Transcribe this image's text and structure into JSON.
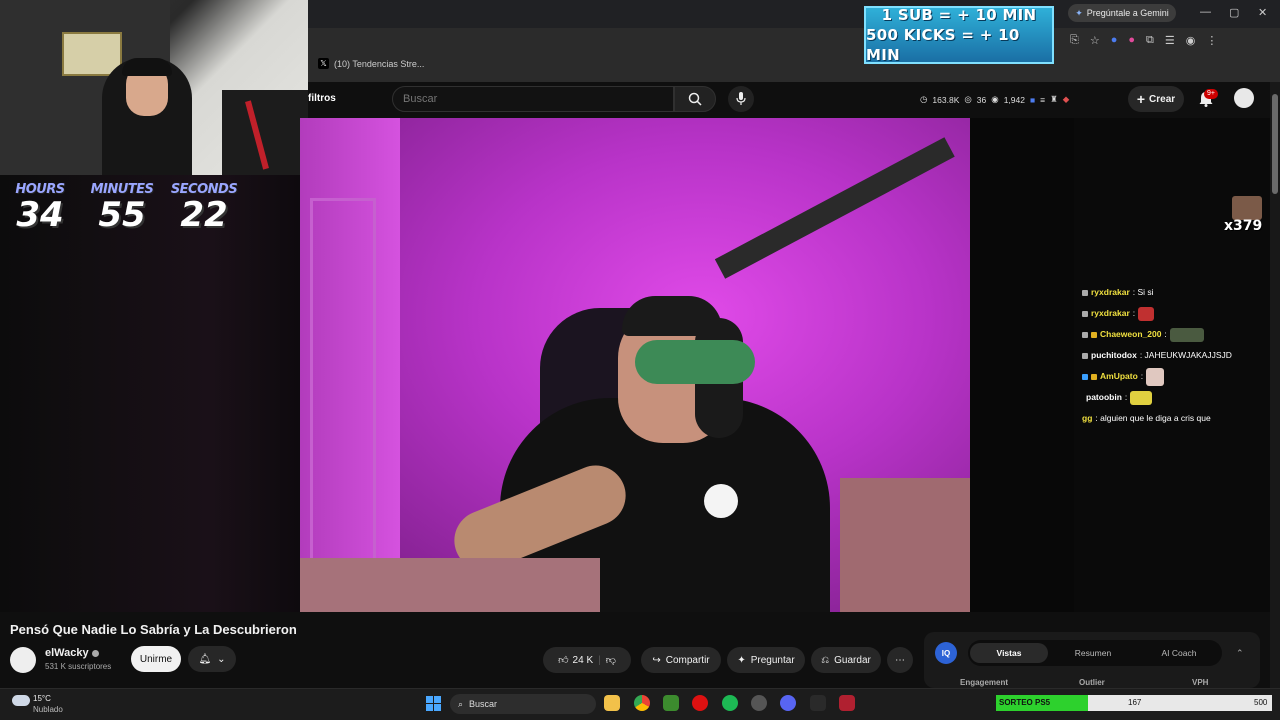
{
  "browser": {
    "tab_title": "(10) Tendencias Stre...",
    "gemini_label": "Pregúntale a Gemini"
  },
  "subathon": {
    "line1": "1 SUB = + 10 MIN",
    "line2": "500 KICKS = + 10 MIN"
  },
  "timer": {
    "hours_label": "HOURS",
    "hours": "34",
    "minutes_label": "MINUTES",
    "minutes": "55",
    "seconds_label": "SECONDS",
    "seconds": "22"
  },
  "youtube": {
    "filters_label": "filtros",
    "search_placeholder": "Buscar",
    "stats": {
      "s1": "163.8K",
      "s2": "36",
      "s3": "1,942"
    },
    "create_label": "Crear",
    "notifications_badge": "9+"
  },
  "chat": {
    "multiplier": "x379",
    "messages": [
      {
        "user": "ryxdrakar",
        "user_color": "#f0e040",
        "text": ": Si si"
      },
      {
        "user": "ryxdrakar",
        "user_color": "#f0e040",
        "text": ":"
      },
      {
        "user": "Chaeweon_200",
        "user_color": "#f0e040",
        "text": ":"
      },
      {
        "user": "puchitodox",
        "user_color": "#ffffff",
        "text": ": JAHEUKWJAKAJJSJD"
      },
      {
        "user": "AmUpato",
        "user_color": "#f0e040",
        "text": ":"
      },
      {
        "user": "patoobin",
        "user_color": "#ffffff",
        "text": ":"
      },
      {
        "user": "gg",
        "user_color": "#f0e040",
        "text": ": alguien que le diga a cris que"
      }
    ]
  },
  "video": {
    "title": "Pensó Que Nadie Lo Sabría y La Descubrieron",
    "channel": "elWacky",
    "subscribers": "531 K suscriptores",
    "join_label": "Unirme",
    "likes": "24 K",
    "share_label": "Compartir",
    "ask_label": "Preguntar",
    "save_label": "Guardar"
  },
  "ext_panel": {
    "logo": "IQ",
    "tabs": [
      "Vistas",
      "Resumen",
      "AI Coach"
    ],
    "active_tab": "Vistas",
    "stat_labels": [
      "Engagement",
      "Outlier",
      "VPH"
    ]
  },
  "taskbar": {
    "temperature": "15°C",
    "weather": "Nublado",
    "search_label": "Buscar"
  },
  "sorteo": {
    "label": "SORTEO PS5",
    "current": "167",
    "max": "500",
    "progress": 0.334
  },
  "colors": {
    "accent_red": "#cc0000",
    "timer_label": "#9aa6ff",
    "sorteo_fill": "#2dd12d"
  }
}
